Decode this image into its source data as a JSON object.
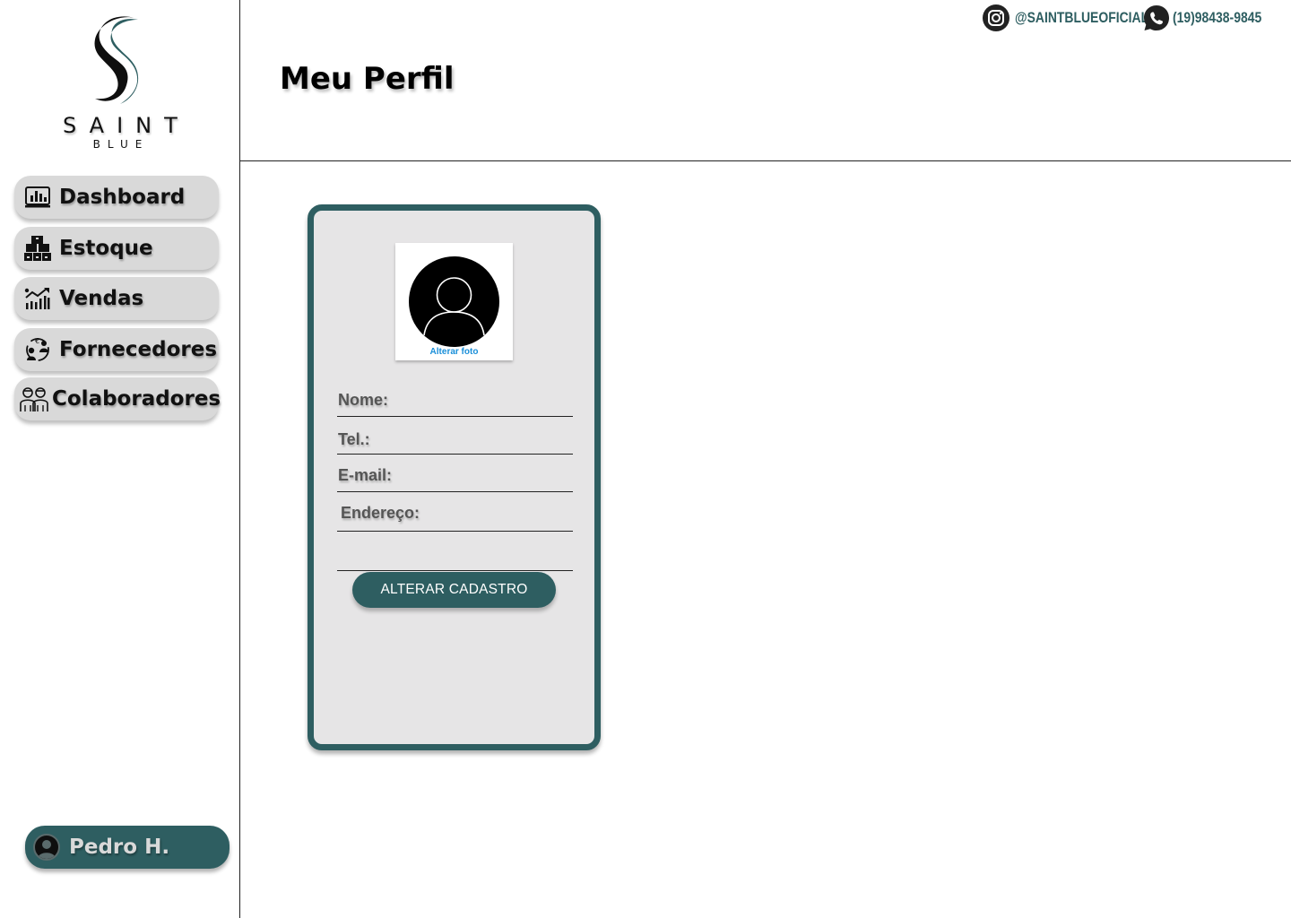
{
  "brand": {
    "name": "SAINT",
    "subname": "BLUE"
  },
  "sidebar": {
    "items": [
      {
        "label": "Dashboard",
        "icon": "dashboard-chart-icon"
      },
      {
        "label": "Estoque",
        "icon": "boxes-stock-icon"
      },
      {
        "label": "Vendas",
        "icon": "sales-growth-icon"
      },
      {
        "label": "Fornecedores",
        "icon": "supplier-exchange-icon"
      },
      {
        "label": "Colaboradores",
        "icon": "team-people-icon"
      }
    ],
    "user": {
      "name": "Pedro H.",
      "icon": "user-avatar-icon"
    }
  },
  "header": {
    "title": "Meu Perfil",
    "instagram": {
      "handle": "@SAINTBLUEOFICIAL",
      "icon": "instagram-icon"
    },
    "whatsapp": {
      "phone": "(19)98438-9845",
      "icon": "whatsapp-icon"
    }
  },
  "profile": {
    "photo_link": "Alterar foto",
    "photo_icon": "default-avatar-icon",
    "fields": {
      "name": "Nome:",
      "phone": "Tel.:",
      "email": "E-mail:",
      "address": "Endereço:"
    },
    "submit_label": "ALTERAR CADASTRO"
  },
  "colors": {
    "accent": "#2e5e61",
    "nav_bg": "#d9d9d9",
    "card_bg": "#e6e5e6",
    "link": "#1a8fd9"
  }
}
